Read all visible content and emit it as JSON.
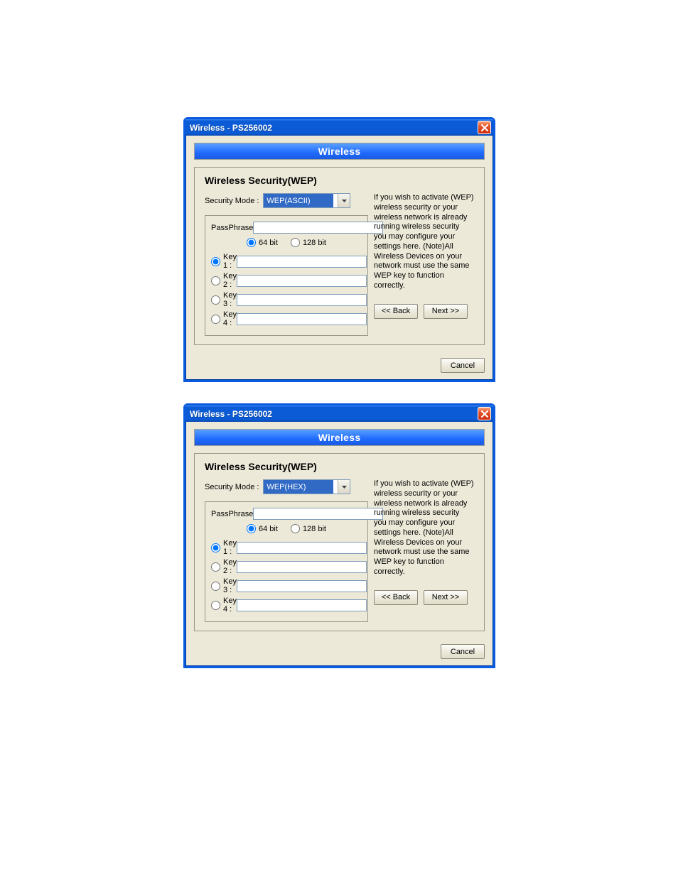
{
  "dialogs": [
    {
      "window_title": "Wireless - PS256002",
      "banner": "Wireless",
      "heading": "Wireless Security(WEP)",
      "security_mode_label": "Security Mode :",
      "security_mode_value": "WEP(ASCII)",
      "passphrase_label": "PassPhrase",
      "passphrase_value": "",
      "bit64_label": "64 bit",
      "bit128_label": "128 bit",
      "bit_selected": "64",
      "keys": [
        {
          "label": "Key 1 :",
          "value": "",
          "selected": true
        },
        {
          "label": "Key 2 :",
          "value": "",
          "selected": false
        },
        {
          "label": "Key 3 :",
          "value": "",
          "selected": false
        },
        {
          "label": "Key 4 :",
          "value": "",
          "selected": false
        }
      ],
      "help_text": "If you wish to activate (WEP) wireless security or your wireless network is already running wireless security you may configure your settings here. (Note)All Wireless Devices on your network must use the same WEP key to function correctly.",
      "back_label": "<< Back",
      "next_label": "Next >>",
      "cancel_label": "Cancel"
    },
    {
      "window_title": "Wireless - PS256002",
      "banner": "Wireless",
      "heading": "Wireless Security(WEP)",
      "security_mode_label": "Security Mode :",
      "security_mode_value": "WEP(HEX)",
      "passphrase_label": "PassPhrase",
      "passphrase_value": "",
      "bit64_label": "64 bit",
      "bit128_label": "128 bit",
      "bit_selected": "64",
      "keys": [
        {
          "label": "Key 1 :",
          "value": "",
          "selected": true
        },
        {
          "label": "Key 2 :",
          "value": "",
          "selected": false
        },
        {
          "label": "Key 3 :",
          "value": "",
          "selected": false
        },
        {
          "label": "Key 4 :",
          "value": "",
          "selected": false
        }
      ],
      "help_text": "If you wish to activate (WEP) wireless security or your wireless network is already running wireless security you may configure your settings here. (Note)All Wireless Devices on your network must use the same WEP key to function correctly.",
      "back_label": "<< Back",
      "next_label": "Next >>",
      "cancel_label": "Cancel"
    }
  ]
}
